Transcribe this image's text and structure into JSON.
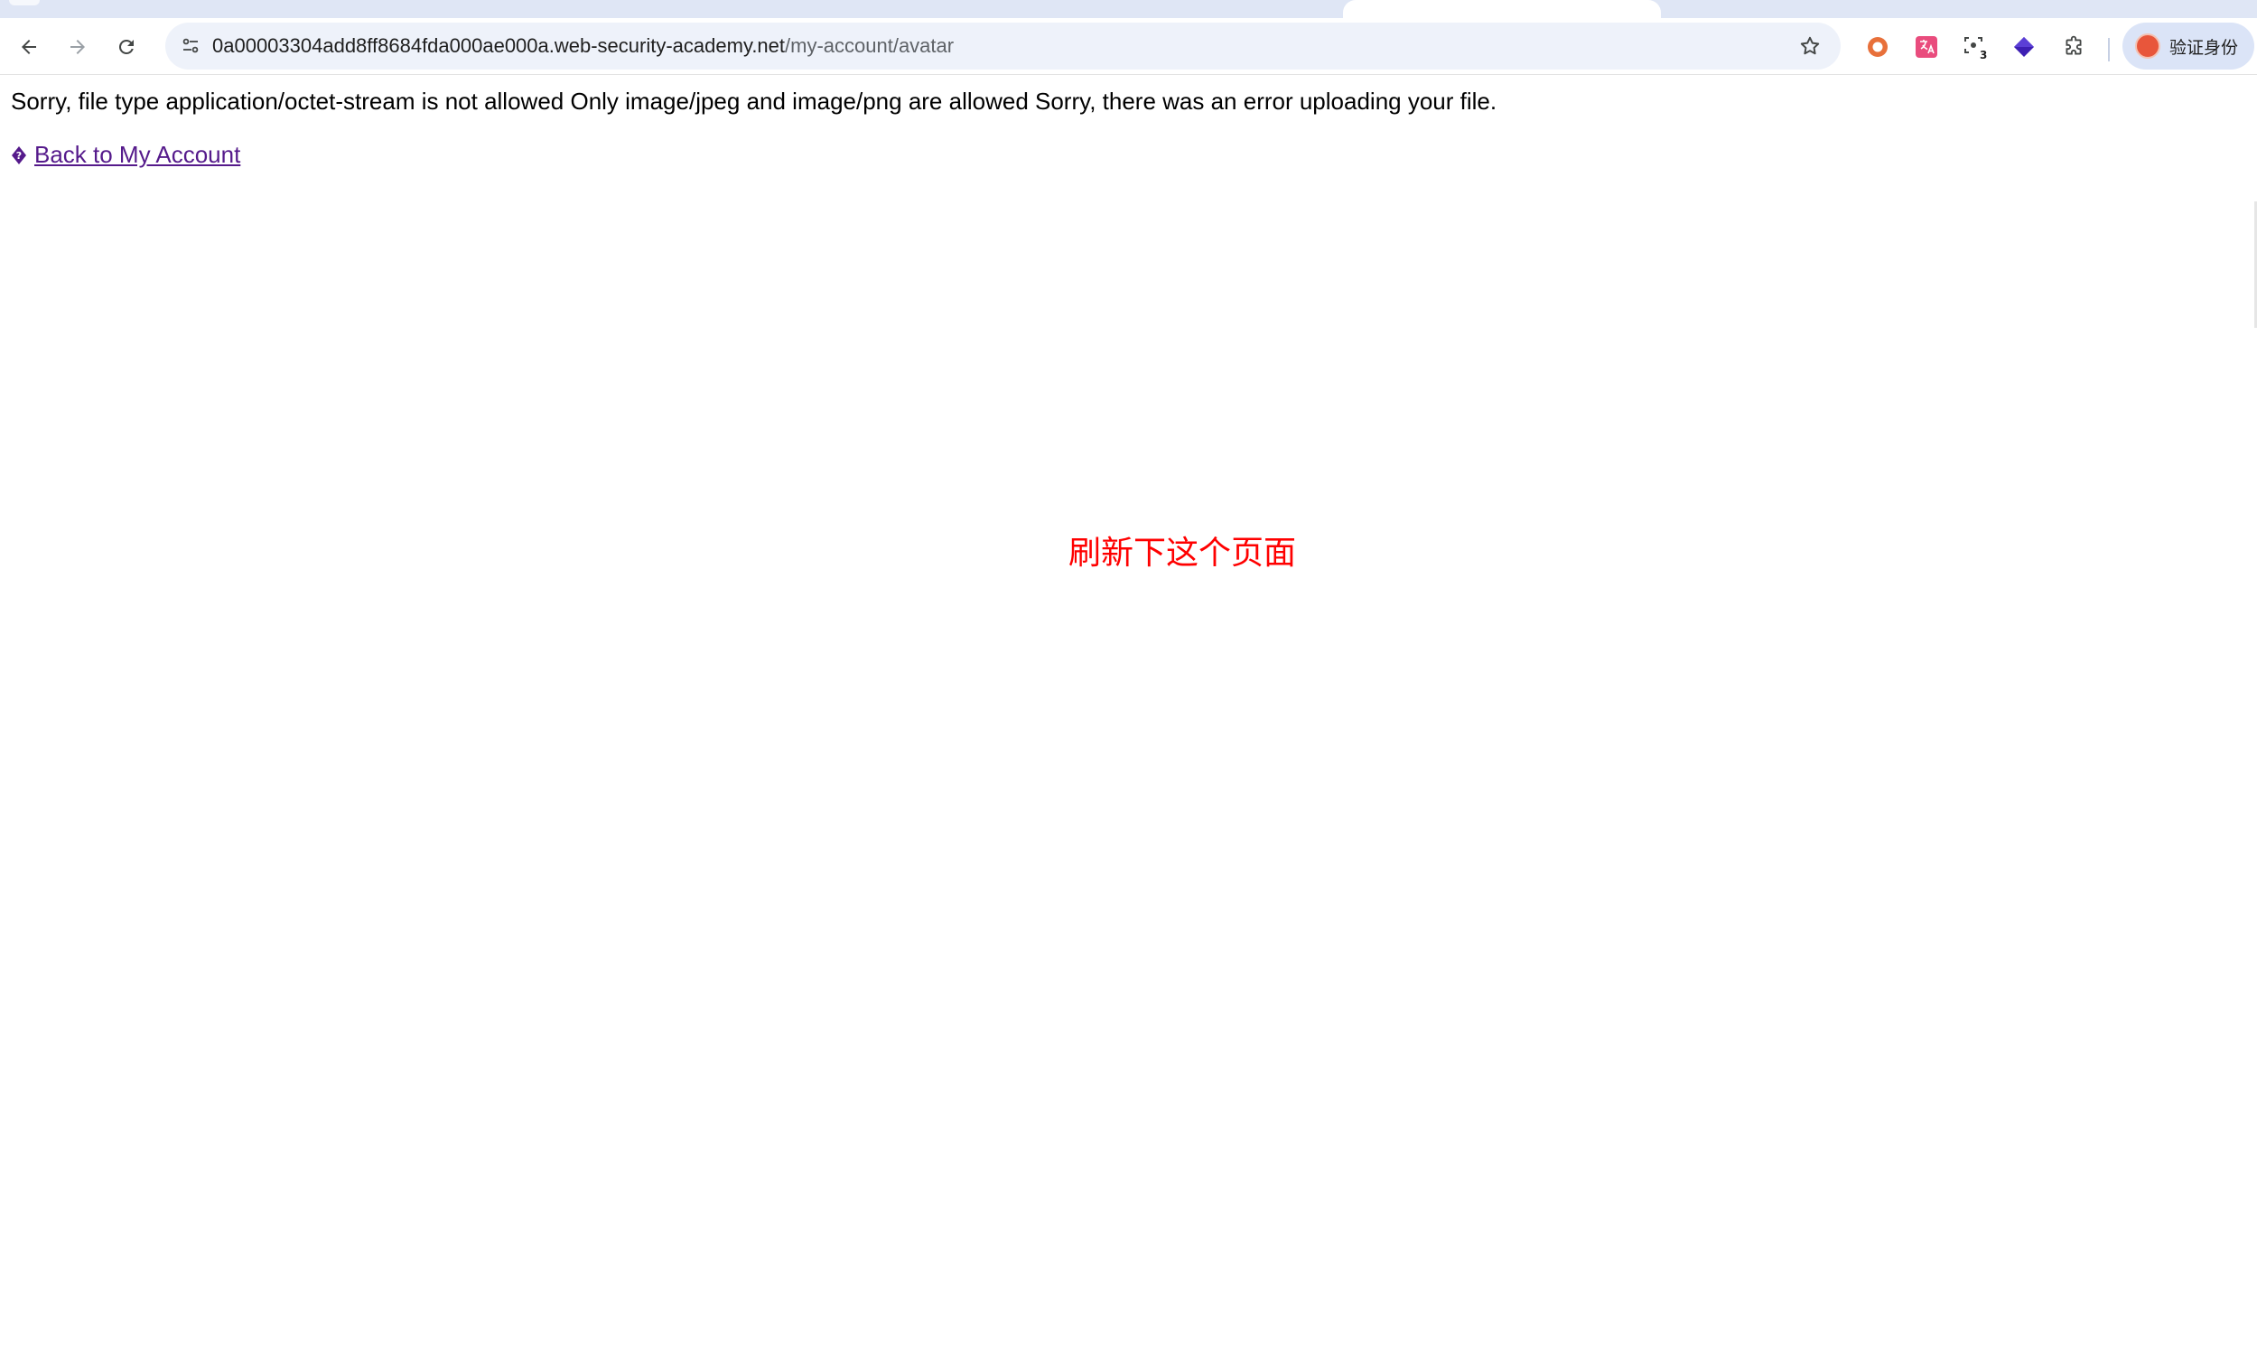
{
  "browser": {
    "address_bar": {
      "host": "0a00003304add8ff8684fda000ae000a.web-security-academy.net",
      "path": "/my-account/avatar"
    },
    "extensions": [
      {
        "name": "record-extension-icon",
        "color": "#e8703a"
      },
      {
        "name": "translate-extension-icon",
        "color": "#e94c7d"
      },
      {
        "name": "screenshot-extension-icon",
        "badge": "3"
      },
      {
        "name": "diamond-extension-icon",
        "color": "#3d1fb3"
      },
      {
        "name": "puzzle-extensions-icon"
      }
    ],
    "profile": {
      "label": "验证身份"
    }
  },
  "page": {
    "message": "Sorry, file type application/octet-stream is not allowed Only image/jpeg and image/png are allowed Sorry, there was an error uploading your file.",
    "back_link": "Back to My Account",
    "annotation": "刷新下这个页面"
  },
  "colors": {
    "link": "#551a8b",
    "annotation": "#ff0000",
    "omnibox": "#eef2fa"
  }
}
